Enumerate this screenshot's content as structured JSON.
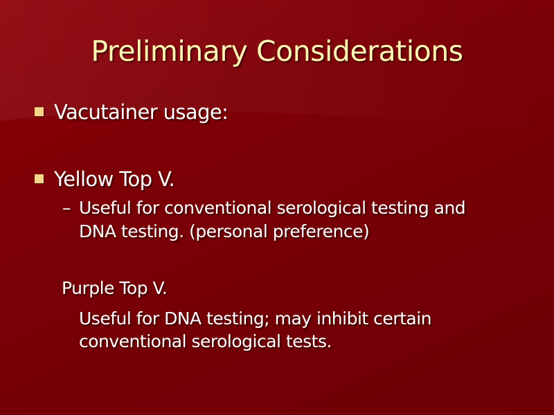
{
  "slide": {
    "title": "Preliminary Considerations",
    "colors": {
      "background": "#7e0006",
      "title": "#fff5b4",
      "body_text": "#ffffff",
      "bullet": "#f5d58a"
    },
    "bullets": [
      {
        "icon": "square-bullet-icon",
        "text": "Vacutainer usage:"
      },
      {
        "icon": "square-bullet-icon",
        "text": "Yellow Top V.",
        "sub": {
          "dash": "–",
          "line1": "Useful for conventional serological testing and",
          "line2": "DNA testing. (personal preference)"
        }
      }
    ],
    "purple": {
      "heading": "Purple Top V.",
      "line1": "Useful for DNA testing; may inhibit certain",
      "line2": "conventional serological tests."
    }
  }
}
